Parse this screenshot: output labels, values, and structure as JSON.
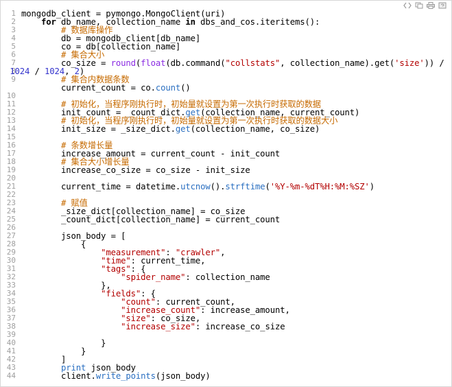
{
  "toolbar": {
    "items": [
      {
        "name": "view-source-icon"
      },
      {
        "name": "copy-icon"
      },
      {
        "name": "print-icon"
      },
      {
        "name": "help-icon"
      }
    ]
  },
  "line_numbers": [
    "1",
    "2",
    "3",
    "4",
    "5",
    "6",
    "7",
    "8",
    "9",
    "",
    "10",
    "11",
    "12",
    "13",
    "14",
    "15",
    "16",
    "17",
    "18",
    "19",
    "20",
    "21",
    "22",
    "23",
    "24",
    "25",
    "26",
    "27",
    "28",
    "29",
    "30",
    "31",
    "32",
    "33",
    "34",
    "35",
    "36",
    "37",
    "38",
    "39",
    "40",
    "41",
    "42",
    "43",
    "44"
  ],
  "code": {
    "l1": "mongodb_client = pymongo.MongoClient(uri)",
    "l2_for": "for",
    "l2_rest": " db_name, collection_name ",
    "l2_in": "in",
    "l2_tail": " dbs_and_cos.iteritems():",
    "l3": "# 数据库操作",
    "l4": "db = mongodb_client[db_name]",
    "l5": "co = db[collection_name]",
    "l6": "# 集合大小",
    "l7a": "co_size = ",
    "l7b": "round",
    "l7c": "(",
    "l7d": "float",
    "l7e": "(db.command(",
    "l7f": "\"collstats\"",
    "l7g": ", collection_name).get(",
    "l7h": "'size'",
    "l7i": ")) /",
    "l7w_a": "1024",
    "l7w_b": " / ",
    "l7w_c": "1024",
    "l7w_d": ", ",
    "l7w_e": "2",
    "l7w_f": ")",
    "l8": "# 集合内数据条数",
    "l9a": "current_count = co.",
    "l9b": "count",
    "l9c": "()",
    "l10": "",
    "l11": "# 初始化，当程序刚执行时，初始量就设置为第一次执行时获取的数据",
    "l12a": "init_count = _count_dict.",
    "l12b": "get",
    "l12c": "(collection_name, current_count)",
    "l13": "# 初始化，当程序刚执行时，初始量就设置为第一次执行时获取的数据大小",
    "l14a": "init_size = _size_dict.",
    "l14b": "get",
    "l14c": "(collection_name, co_size)",
    "l15": "",
    "l16": "# 条数增长量",
    "l17": "increase_amount = current_count - init_count",
    "l18": "# 集合大小增长量",
    "l19": "increase_co_size = co_size - init_size",
    "l20": "",
    "l21a": "current_time = datetime.",
    "l21b": "utcnow",
    "l21c": "().",
    "l21d": "strftime",
    "l21e": "(",
    "l21f": "'%Y-%m-%dT%H:%M:%SZ'",
    "l21g": ")",
    "l22": "",
    "l23": "# 赋值",
    "l24": "_size_dict[collection_name] = co_size",
    "l25": "_count_dict[collection_name] = current_count",
    "l26": "",
    "l27": "json_body = [",
    "l28": "{",
    "l29a": "\"measurement\"",
    "l29b": ": ",
    "l29c": "\"crawler\"",
    "l29d": ",",
    "l30a": "\"time\"",
    "l30b": ": current_time,",
    "l31a": "\"tags\"",
    "l31b": ": {",
    "l32a": "\"spider_name\"",
    "l32b": ": collection_name",
    "l33": "},",
    "l34a": "\"fields\"",
    "l34b": ": {",
    "l35a": "\"count\"",
    "l35b": ": current_count,",
    "l36a": "\"increase_count\"",
    "l36b": ": increase_amount,",
    "l37a": "\"size\"",
    "l37b": ": co_size,",
    "l38a": "\"increase_size\"",
    "l38b": ": increase_co_size",
    "l39": "",
    "l40": "}",
    "l41": "}",
    "l42": "]",
    "l43a": "print",
    "l43b": " json_body",
    "l44a": "client.",
    "l44b": "write_points",
    "l44c": "(json_body)"
  }
}
